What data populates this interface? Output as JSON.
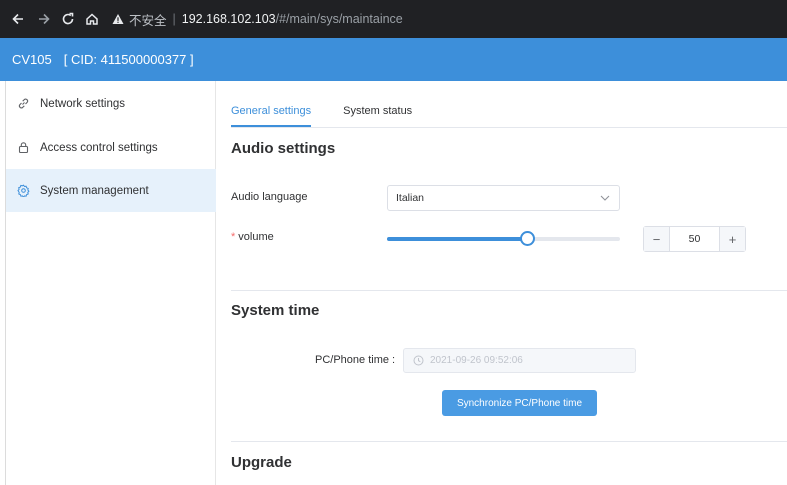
{
  "browser": {
    "back_icon": "arrow-left-icon",
    "forward_icon": "arrow-right-icon",
    "reload_icon": "reload-icon",
    "home_icon": "home-icon",
    "warning_icon": "warning-triangle-icon",
    "insecure_label": "不安全",
    "separator": "|",
    "host": "192.168.102.103",
    "path": "/#/main/sys/maintaince"
  },
  "header": {
    "device_name": "CV105",
    "cid": "[ CID: 411500000377 ]",
    "color": "#3d8fda"
  },
  "sidebar": {
    "items": [
      {
        "label": "Network settings",
        "icon": "link-icon",
        "active": false
      },
      {
        "label": "Access control settings",
        "icon": "lock-icon",
        "active": false
      },
      {
        "label": "System management",
        "icon": "gear-icon",
        "active": true
      }
    ]
  },
  "tabs": [
    {
      "label": "General settings",
      "active": true
    },
    {
      "label": "System status",
      "active": false
    }
  ],
  "audio": {
    "title": "Audio settings",
    "language_label": "Audio language",
    "language_value": "Italian",
    "volume_required_mark": "*",
    "volume_label": "volume",
    "volume_value": "50",
    "volume_fraction": 0.6,
    "minus_label": "−",
    "plus_label": "+"
  },
  "system_time": {
    "title": "System time",
    "pc_label": "PC/Phone time :",
    "pc_value": "2021-09-26 09:52:06",
    "sync_button": "Synchronize PC/Phone time"
  },
  "upgrade": {
    "title": "Upgrade"
  },
  "colors": {
    "accent": "#3d8fda",
    "required": "#f56c6c"
  }
}
